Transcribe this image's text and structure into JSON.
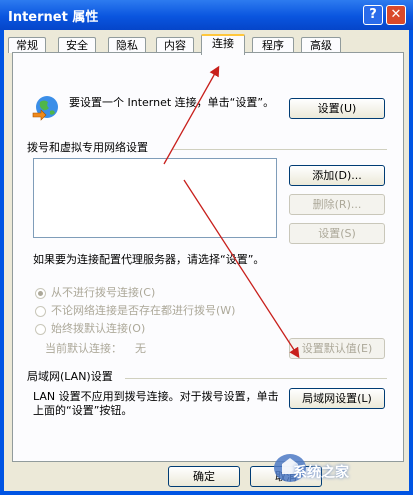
{
  "window": {
    "title": "Internet 属性",
    "help_label": "?",
    "close_label": "✕"
  },
  "tabs": [
    {
      "label": "常规"
    },
    {
      "label": "安全"
    },
    {
      "label": "隐私"
    },
    {
      "label": "内容"
    },
    {
      "label": "连接"
    },
    {
      "label": "程序"
    },
    {
      "label": "高级"
    }
  ],
  "active_tab": "连接",
  "setup": {
    "text": "要设置一个 Internet 连接，单击“设置”。",
    "button_label": "设置(U)"
  },
  "dialup": {
    "group_label": "拨号和虚拟专用网络设置",
    "add_label": "添加(D)...",
    "remove_label": "删除(R)...",
    "settings_label": "设置(S)",
    "proxy_text": "如果要为连接配置代理服务器，请选择“设置”。",
    "options": [
      {
        "label": "从不进行拨号连接(C)",
        "selected": true
      },
      {
        "label": "不论网络连接是否存在都进行拨号(W)",
        "selected": false
      },
      {
        "label": "始终拨默认连接(O)",
        "selected": false
      }
    ],
    "current_default_label": "当前默认连接：",
    "current_default_value": "无",
    "set_default_label": "设置默认值(E)"
  },
  "lan": {
    "group_label": "局域网(LAN)设置",
    "text": "LAN 设置不应用到拨号连接。对于拨号设置，单击上面的“设置”按钮。",
    "button_label": "局域网设置(L)"
  },
  "footer": {
    "ok_label": "确定",
    "cancel_label": "取消"
  },
  "watermark": {
    "text": "系统之家"
  },
  "colors": {
    "titlebar": "#0a55df",
    "dialog_bg": "#ece9d8",
    "annotation_arrow": "#c8201c"
  }
}
